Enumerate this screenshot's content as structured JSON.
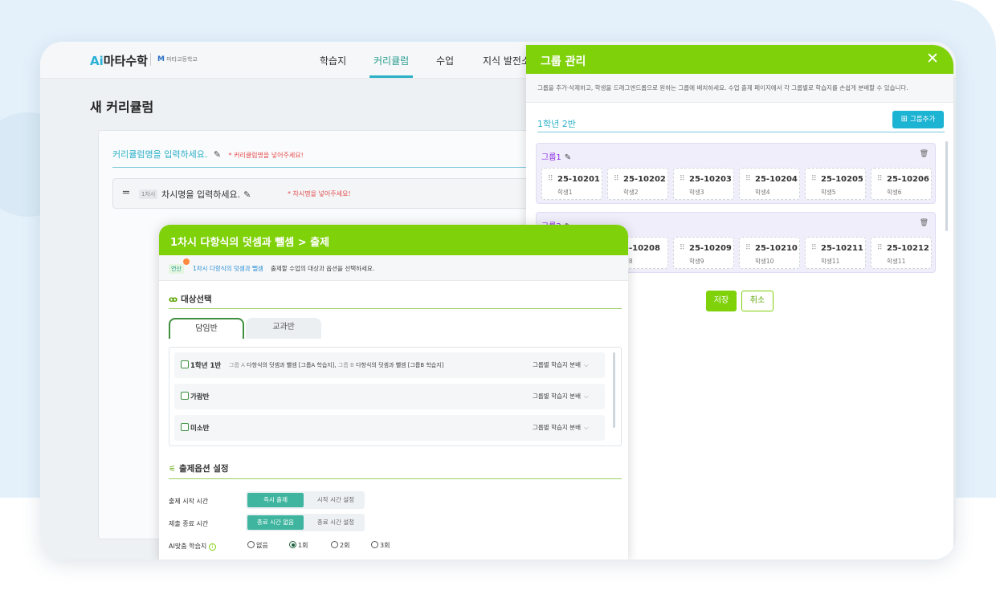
{
  "app": {
    "logo_ai": "Ai",
    "logo_name": "마타수학",
    "school_mark": "M",
    "school_name": "마타고등학교",
    "nav": [
      "학습지",
      "커리큘럼",
      "수업",
      "지식 발전소"
    ],
    "page_title": "새 커리큘럼",
    "curriculum_placeholder": "커리큘럼명을 입력하세요.",
    "curriculum_required": "* 커리큘럼명을 넣어주세요!",
    "session_badge": "1차시",
    "session_placeholder": "차시명을 입력하세요.",
    "session_required": "* 차시명을 넣어주세요!"
  },
  "group_panel": {
    "title": "그룹 관리",
    "close": "✕",
    "description": "그룹을 추가·삭제하고, 학생을 드래그앤드롭으로 원하는 그룹에 배치하세요.  수업 출제 페이지에서 각 그룹별로 학습지를 손쉽게 분배할 수 있습니다.",
    "class_name": "1학년 2반",
    "add_group": "그룹추가",
    "groups": [
      {
        "name": "그룹1",
        "students": [
          {
            "id": "25-10201",
            "name": "학생1"
          },
          {
            "id": "25-10202",
            "name": "학생2"
          },
          {
            "id": "25-10203",
            "name": "학생3"
          },
          {
            "id": "25-10204",
            "name": "학생4"
          },
          {
            "id": "25-10205",
            "name": "학생5"
          },
          {
            "id": "25-10206",
            "name": "학생6"
          }
        ]
      },
      {
        "name": "그룹2",
        "students": [
          {
            "id": "5-10208",
            "name": "생8"
          },
          {
            "id": "25-10209",
            "name": "학생9"
          },
          {
            "id": "25-10210",
            "name": "학생10"
          },
          {
            "id": "25-10211",
            "name": "학생11"
          },
          {
            "id": "25-10212",
            "name": "학생11"
          }
        ]
      }
    ],
    "save": "저장",
    "cancel": "취소"
  },
  "assign_modal": {
    "title": "1차시 다항식의 덧셈과 뺄셈 > 출제",
    "tag": "연산",
    "info_link": "1차시 다항식의 덧셈과 뺄셈",
    "info_rest": "출제할 수업의 대상과 옵션을 선택하세요.",
    "target_title": "대상선택",
    "tabs": [
      "담임반",
      "교과반"
    ],
    "classes": [
      {
        "name": "1학년 1반",
        "group_a_label": "그룹 A",
        "group_a_value": "다항식의 덧셈과 뺄셈 [그룹A 학습지],",
        "group_b_label": "그룹 B",
        "group_b_value": "다항식의 덧셈과 뺄셈 [그룹B 학습지]",
        "select": "그룹별 학습지 분배"
      },
      {
        "name": "가람반",
        "select": "그룹별 학습지 분배"
      },
      {
        "name": "미소반",
        "select": "그룹별 학습지 분배"
      }
    ],
    "option_title": "출제옵션 설정",
    "start_label": "출제 시작 시간",
    "start_options": [
      "즉시 출제",
      "시작 시간 설정"
    ],
    "end_label": "제출 종료 시간",
    "end_options": [
      "종료 시간 없음",
      "종료 시간 설정"
    ],
    "ai_label": "AI맞춤 학습지",
    "ai_options": [
      "없음",
      "1회",
      "2회",
      "3회"
    ],
    "ai_selected": "1회"
  }
}
